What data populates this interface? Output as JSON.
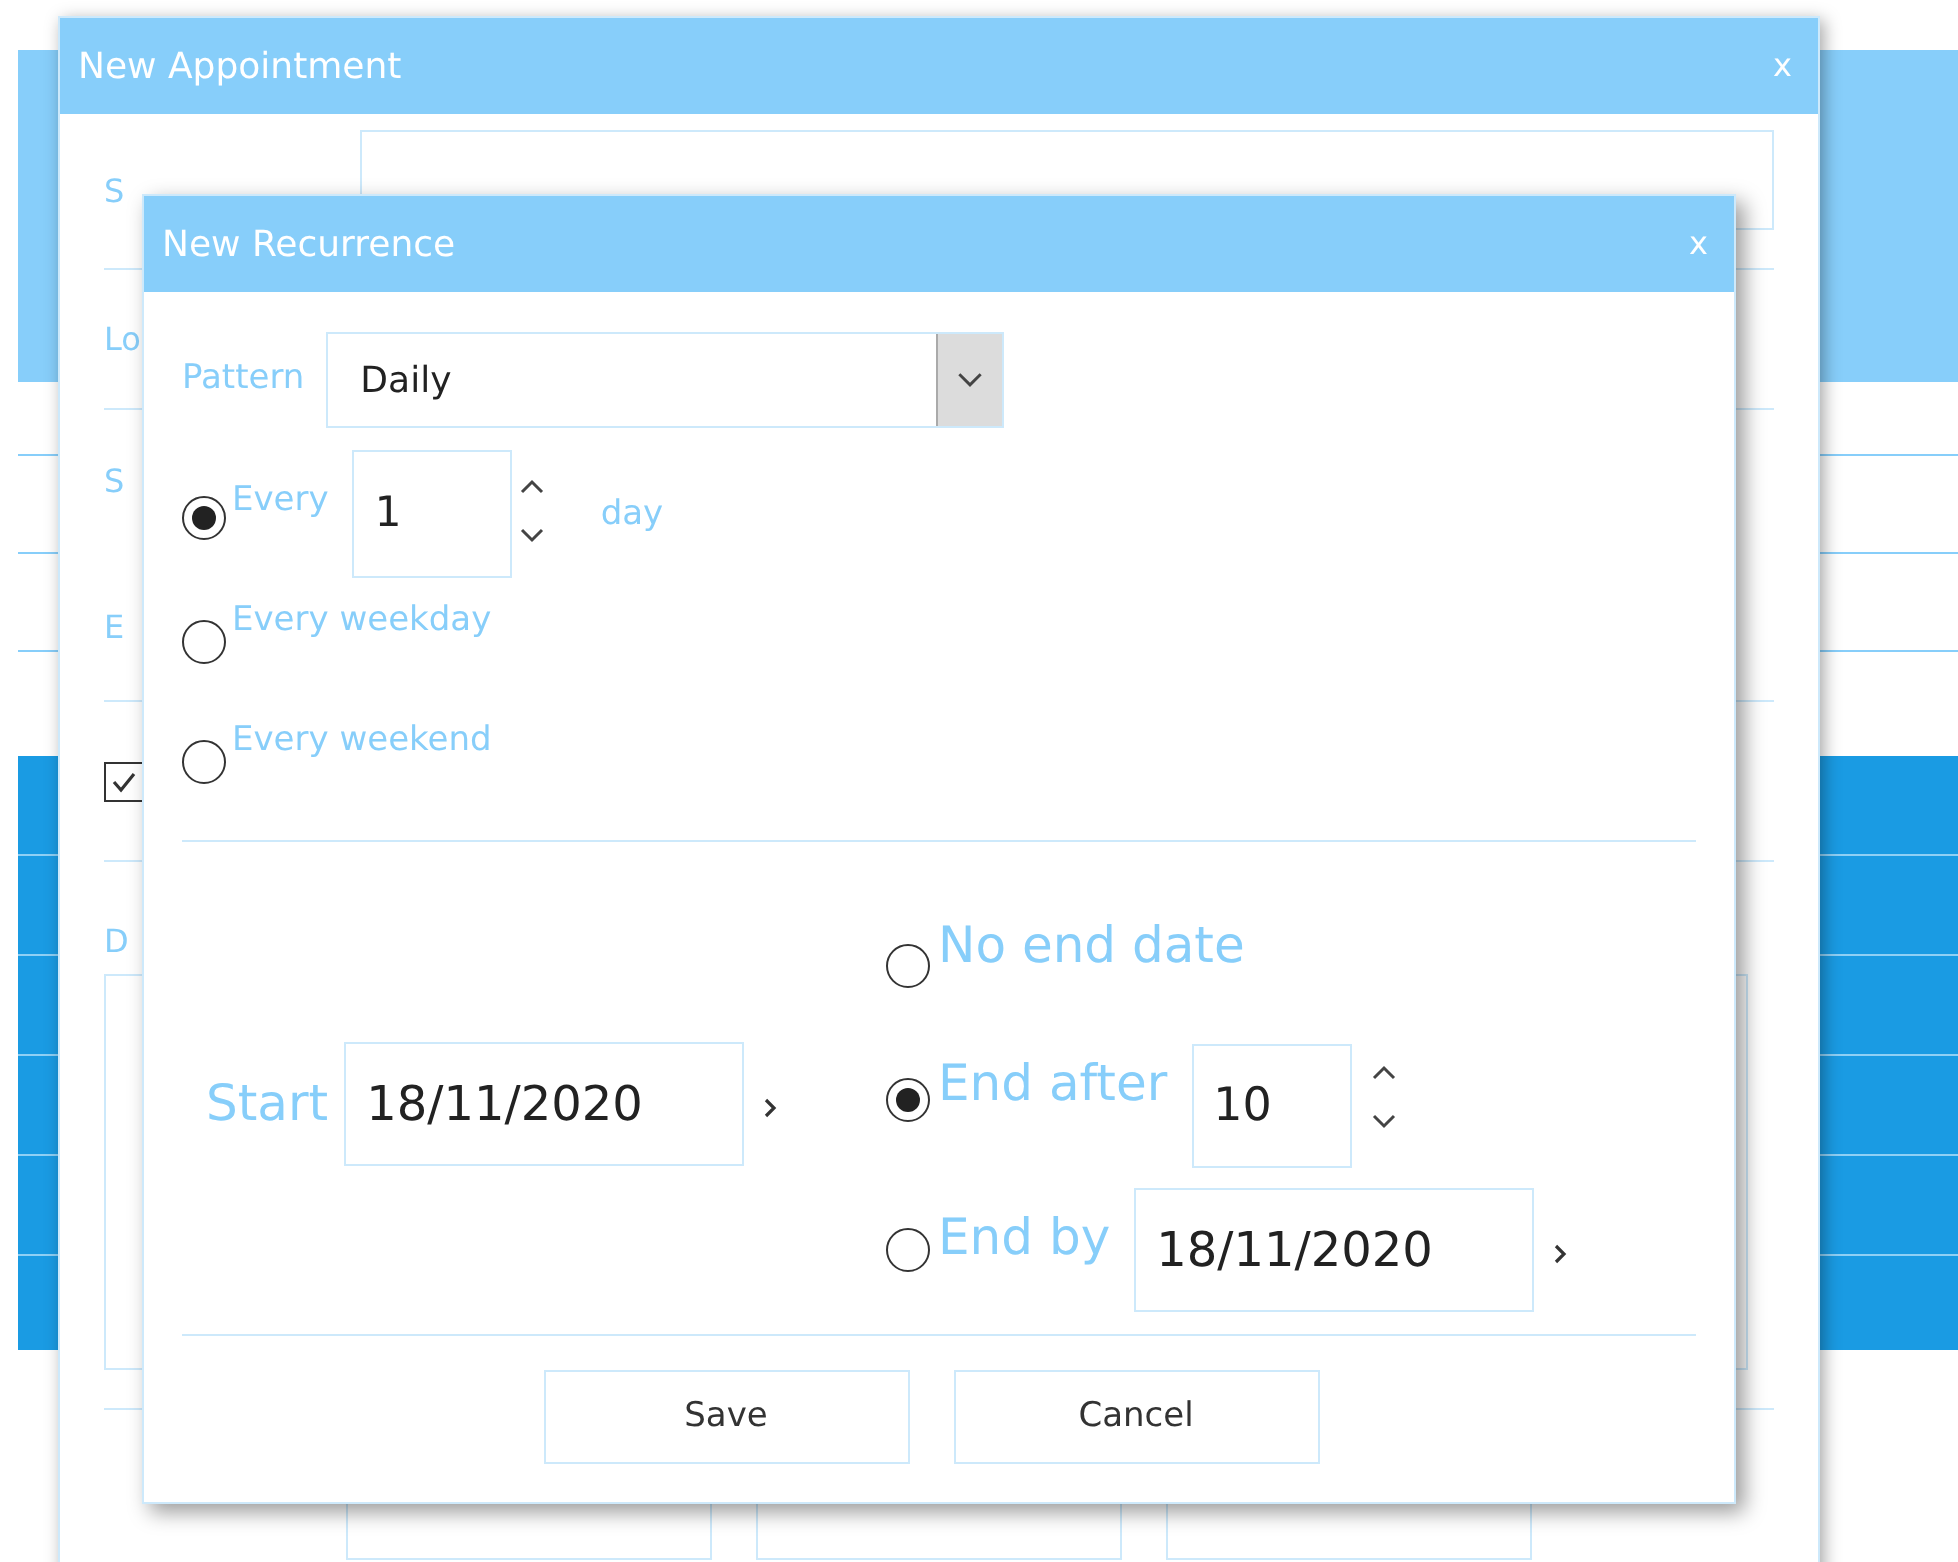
{
  "appointment_dialog": {
    "title": "New Appointment",
    "close": "x",
    "labels": [
      "S",
      "Lo",
      "S",
      "E"
    ],
    "all_day": {
      "checked": true
    },
    "description_label": "D"
  },
  "recurrence_dialog": {
    "title": "New Recurrence",
    "close": "x",
    "pattern": {
      "label": "Pattern",
      "value": "Daily"
    },
    "frequency_options": [
      {
        "kind": "interval",
        "label": "Every",
        "selected": true,
        "value": "1",
        "unit": "day"
      },
      {
        "kind": "plain",
        "label": "Every weekday",
        "selected": false
      },
      {
        "kind": "plain",
        "label": "Every weekend",
        "selected": false
      }
    ],
    "start": {
      "label": "Start",
      "value": "18/11/2020"
    },
    "end_options": [
      {
        "kind": "none",
        "label": "No end date",
        "selected": false
      },
      {
        "kind": "count",
        "label": "End after",
        "selected": true,
        "value": "10"
      },
      {
        "kind": "date",
        "label": "End by",
        "selected": false,
        "value": "18/11/2020"
      }
    ],
    "buttons": [
      "Save",
      "Cancel"
    ]
  }
}
